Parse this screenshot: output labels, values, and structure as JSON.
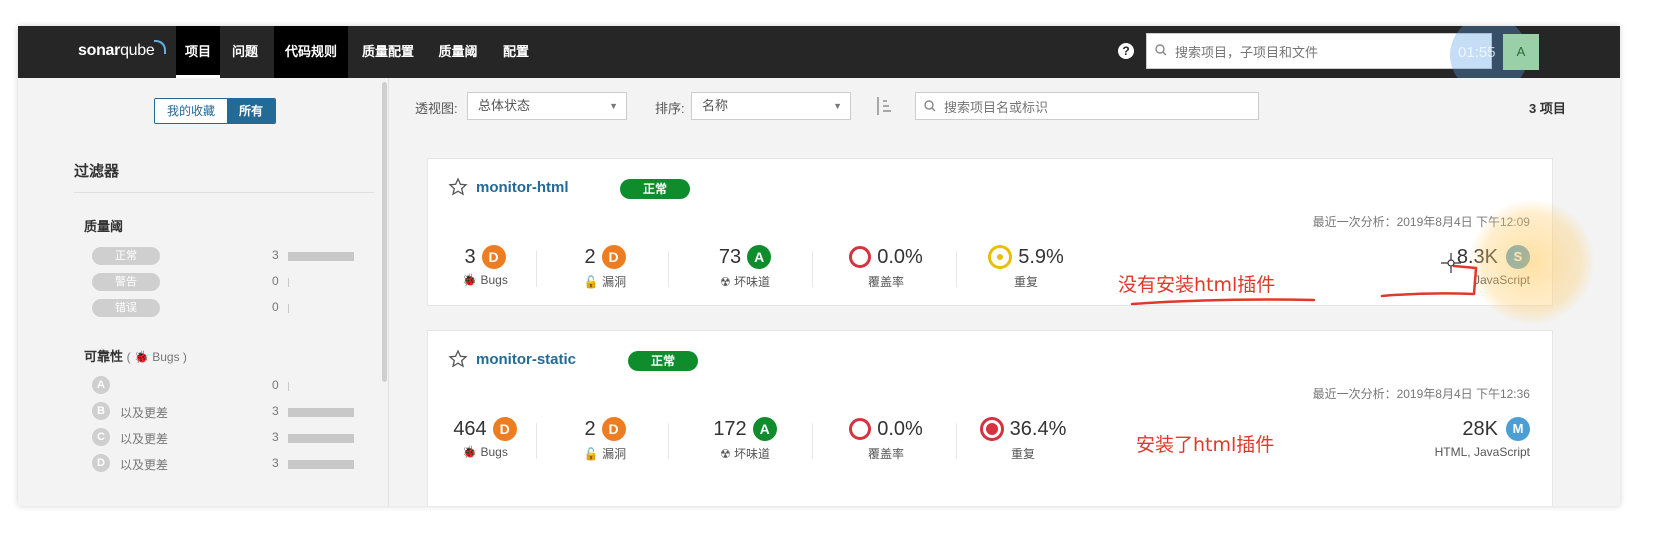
{
  "header": {
    "logo_bold": "sonar",
    "logo_rest": "qube",
    "nav": [
      "项目",
      "问题",
      "代码规则",
      "质量配置",
      "质量阈",
      "配置"
    ],
    "active_nav_index": 0,
    "search_placeholder": "搜索项目，子项目和文件",
    "avatar_letter": "A",
    "overlay_text": "01:55"
  },
  "sidebar": {
    "toggle": {
      "favorites": "我的收藏",
      "all": "所有"
    },
    "filter_title": "过滤器",
    "quality_gate": {
      "title": "质量阈",
      "rows": [
        {
          "label": "正常",
          "count": "3",
          "fraction": 1.0
        },
        {
          "label": "警告",
          "count": "0",
          "fraction": 0.0
        },
        {
          "label": "错误",
          "count": "0",
          "fraction": 0.0
        }
      ]
    },
    "reliability": {
      "title": "可靠性",
      "subtitle": "( 🐞 Bugs )",
      "rows": [
        {
          "grade": "A",
          "label": "",
          "count": "0",
          "fraction": 0.0
        },
        {
          "grade": "B",
          "label": "以及更差",
          "count": "3",
          "fraction": 1.0
        },
        {
          "grade": "C",
          "label": "以及更差",
          "count": "3",
          "fraction": 1.0
        },
        {
          "grade": "D",
          "label": "以及更差",
          "count": "3",
          "fraction": 1.0
        }
      ]
    }
  },
  "controls": {
    "perspective_label": "透视图:",
    "perspective_value": "总体状态",
    "sort_label": "排序:",
    "sort_value": "名称",
    "search_placeholder": "搜索项目名或标识",
    "project_count": "3 项目"
  },
  "projects": [
    {
      "name": "monitor-html",
      "gate": "正常",
      "last_analysis": "最近一次分析：2019年8月4日 下午12:09",
      "bugs": "3",
      "bugs_rating": "D",
      "bugs_label": "Bugs",
      "vulns": "2",
      "vulns_rating": "D",
      "vulns_label": "漏洞",
      "smells": "73",
      "smells_rating": "A",
      "smells_label": "坏味道",
      "coverage": "0.0%",
      "coverage_label": "覆盖率",
      "duplication": "5.9%",
      "duplication_label": "重复",
      "size": "8.3K",
      "size_rating": "S",
      "languages": "JavaScript",
      "annotation": "没有安装html插件"
    },
    {
      "name": "monitor-static",
      "gate": "正常",
      "last_analysis": "最近一次分析：2019年8月4日 下午12:36",
      "bugs": "464",
      "bugs_rating": "D",
      "bugs_label": "Bugs",
      "vulns": "2",
      "vulns_rating": "D",
      "vulns_label": "漏洞",
      "smells": "172",
      "smells_rating": "A",
      "smells_label": "坏味道",
      "coverage": "0.0%",
      "coverage_label": "覆盖率",
      "duplication": "36.4%",
      "duplication_label": "重复",
      "size": "28K",
      "size_rating": "M",
      "languages": "HTML, JavaScript",
      "annotation": "安装了html插件"
    }
  ],
  "colors": {
    "accent": "#236a97",
    "gate_ok": "#0f8d2c",
    "rating_D": "#ed7d20",
    "rating_A": "#0f8d2c",
    "annotation": "#e0382b"
  }
}
